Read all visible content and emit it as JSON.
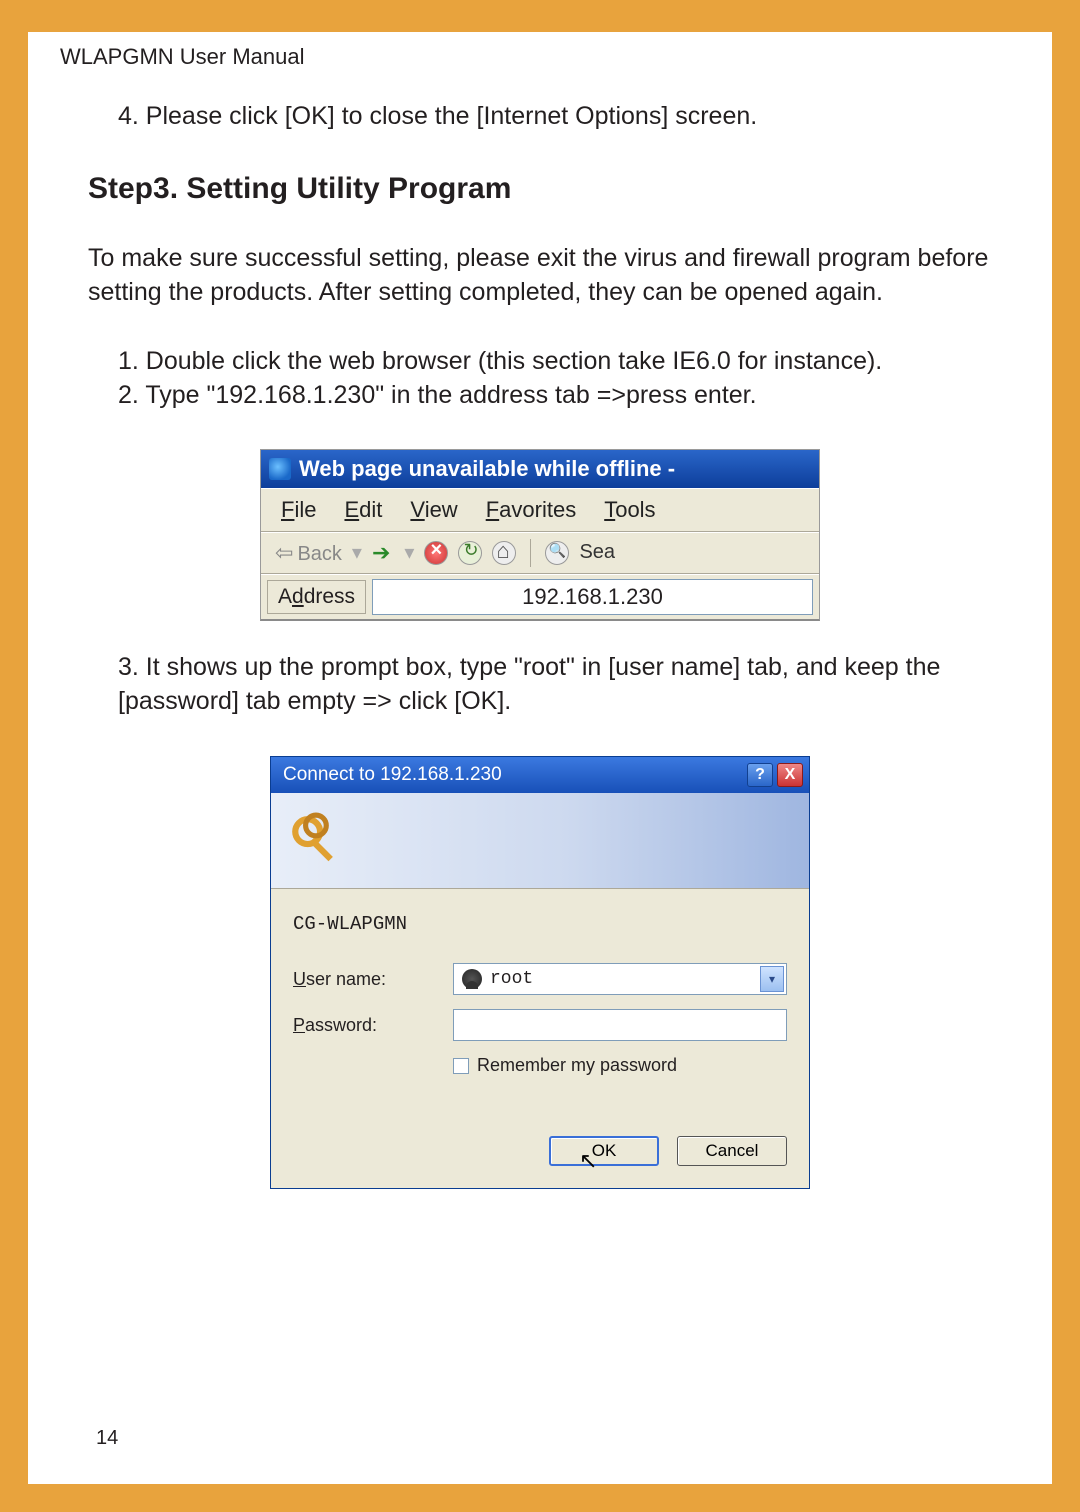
{
  "header": "WLAPGMN User Manual",
  "step4": "4. Please click [OK] to close the [Internet Options] screen.",
  "heading": "Step3. Setting Utility Program",
  "intro": "To make sure successful setting, please exit the virus and firewall program before setting the products. After setting completed, they can be opened again.",
  "li1": "1. Double click the web browser (this section take IE6.0 for instance).",
  "li2": "2. Type \"192.168.1.230\" in the address tab =>press enter.",
  "li3": "3. It shows up the prompt box, type \"root\" in [user name] tab, and keep the [password] tab empty => click [OK].",
  "ie": {
    "title": "Web page unavailable while offline - ",
    "menus": {
      "file": "File",
      "edit": "Edit",
      "view": "View",
      "favorites": "Favorites",
      "tools": "Tools"
    },
    "back": "Back",
    "search": "Sea",
    "address_label_pre": "A",
    "address_label_ul": "d",
    "address_label_post": "dress",
    "address_value": "192.168.1.230"
  },
  "dialog": {
    "title": "Connect to 192.168.1.230",
    "realm": "CG-WLAPGMN",
    "user_label_ul": "U",
    "user_label_rest": "ser name:",
    "pass_label_ul": "P",
    "pass_label_rest": "assword:",
    "user_value": "root",
    "remember_ul": "R",
    "remember_rest": "emember my password",
    "ok": "OK",
    "cancel": "Cancel"
  },
  "page_number": "14"
}
